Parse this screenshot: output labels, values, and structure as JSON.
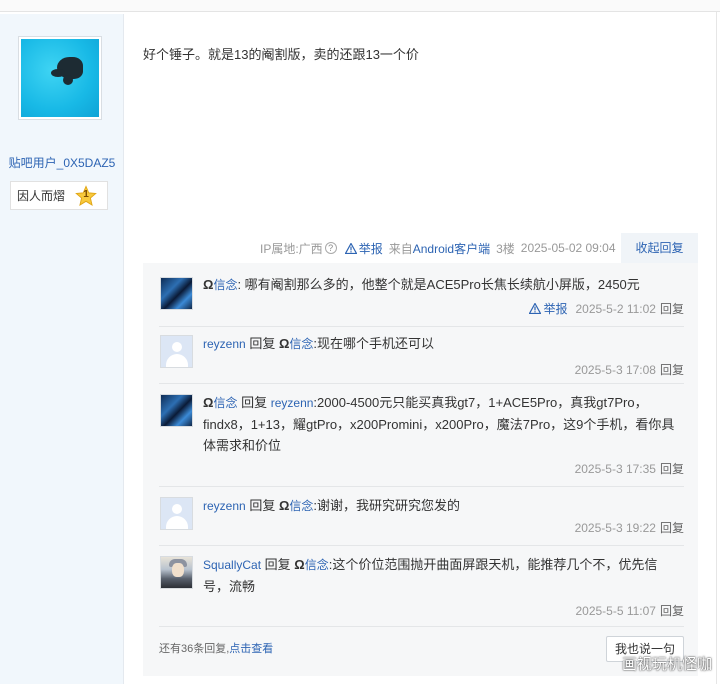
{
  "author": {
    "username": "贴吧用户_0X5DAZ5",
    "level_name": "因人而熠",
    "level_number": "1"
  },
  "post": {
    "content": "好个锤子。就是13的阉割版，卖的还跟13一个价",
    "ip_label": "IP属地:广西",
    "help_icon": "?",
    "report_label": "举报",
    "source_prefix": "来自",
    "source_link": "Android客户端",
    "floor": "3楼",
    "timestamp": "2025-05-02 09:04",
    "collapse_label": "收起回复"
  },
  "replies": [
    {
      "avatar": "dark-blue-avatar",
      "prefix": "Ω",
      "user": "信念",
      "reply_word": "",
      "reply_prefix": "",
      "reply_to": "",
      "text": ": 哪有阉割那么多的，他整个就是ACE5Pro长焦长续航小屏版，2450元",
      "report_label": "举报",
      "time": "2025-5-2 11:02",
      "reply_label": "回复"
    },
    {
      "avatar": "default-avatar",
      "prefix": "",
      "user": "reyzenn",
      "reply_word": "回复",
      "reply_prefix": "Ω",
      "reply_to": "信念",
      "text": ":现在哪个手机还可以",
      "time": "2025-5-3 17:08",
      "reply_label": "回复"
    },
    {
      "avatar": "dark-blue-avatar",
      "prefix": "Ω",
      "user": "信念",
      "reply_word": "回复",
      "reply_prefix": "",
      "reply_to": "reyzenn",
      "text": ":2000-4500元只能买真我gt7，1+ACE5Pro，真我gt7Pro，findx8，1+13，耀gtPro，x200Promini，x200Pro，魔法7Pro，这9个手机，看你具体需求和价位",
      "time": "2025-5-3 17:35",
      "reply_label": "回复"
    },
    {
      "avatar": "default-avatar",
      "prefix": "",
      "user": "reyzenn",
      "reply_word": "回复",
      "reply_prefix": "Ω",
      "reply_to": "信念",
      "text": ":谢谢，我研究研究您发的",
      "time": "2025-5-3 19:22",
      "reply_label": "回复"
    },
    {
      "avatar": "anime-avatar",
      "prefix": "",
      "user": "SquallyCat",
      "reply_word": "回复",
      "reply_prefix": "Ω",
      "reply_to": "信念",
      "text": ":这个价位范围抛开曲面屏跟天机，能推荐几个不，优先信号，流畅",
      "time": "2025-5-5 11:07",
      "reply_label": "回复"
    }
  ],
  "footer": {
    "more_prefix": "还有36条回复,",
    "more_link": "点击查看",
    "say_button": "我也说一句"
  },
  "watermark": "画视玩机怪咖",
  "colors": {
    "link": "#2d64b3",
    "sidebar_bg": "#f1f7fc",
    "reply_bg": "#f6f7f8"
  }
}
